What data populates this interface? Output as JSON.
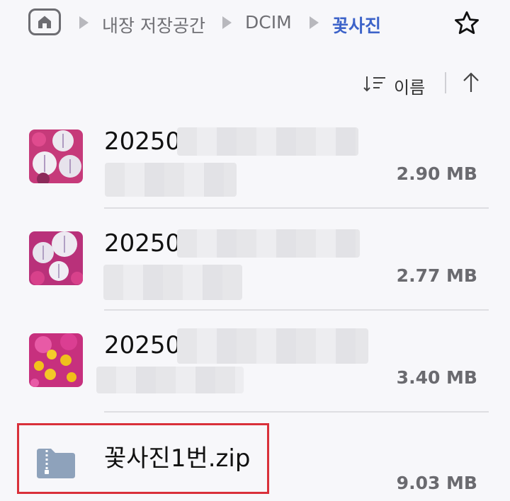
{
  "breadcrumb": {
    "items": [
      {
        "label": "내장 저장공간"
      },
      {
        "label": "DCIM"
      },
      {
        "label": "꽃사진"
      }
    ]
  },
  "sort": {
    "label": "이름"
  },
  "files": [
    {
      "name": "20250",
      "size": "2.90 MB",
      "thumb": "pink-white-petunias"
    },
    {
      "name": "20250",
      "size": "2.77 MB",
      "thumb": "white-pink-petunias"
    },
    {
      "name": "20250",
      "size": "3.40 MB",
      "thumb": "yellow-pink-flowers"
    },
    {
      "name": "꽃사진1번.zip",
      "size": "9.03 MB",
      "thumb": "zip-folder-icon"
    }
  ],
  "colors": {
    "accent": "#3d63c9",
    "highlight": "#d9303a",
    "folder": "#8ea2bb"
  }
}
